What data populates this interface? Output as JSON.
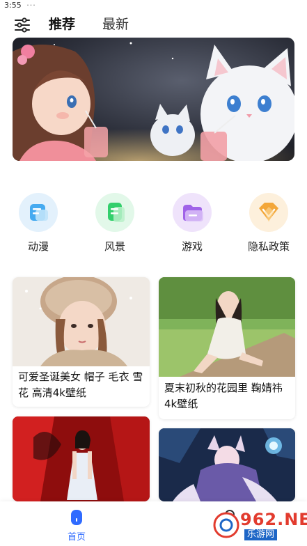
{
  "status_bar": {
    "time": "3:55",
    "more": "···"
  },
  "header": {
    "filter_icon": "sliders-icon",
    "tabs": [
      {
        "label": "推荐",
        "active": true
      },
      {
        "label": "最新",
        "active": false
      }
    ]
  },
  "categories": [
    {
      "label": "动漫",
      "icon": "anime-icon",
      "color": "#3aa7ee"
    },
    {
      "label": "风景",
      "icon": "scenery-icon",
      "color": "#2ecf6f"
    },
    {
      "label": "游戏",
      "icon": "game-icon",
      "color": "#9b5de5"
    },
    {
      "label": "隐私政策",
      "icon": "privacy-icon",
      "color": "#f2a93b"
    }
  ],
  "wallpapers": [
    {
      "title": "可爱圣诞美女 帽子 毛衣 雪花 高清4k壁纸"
    },
    {
      "title": "夏末初秋的花园里 鞠婧祎4k壁纸"
    },
    {
      "title": ""
    },
    {
      "title": ""
    }
  ],
  "bottom_nav": {
    "home_label": "首页",
    "home_icon": "home-icon",
    "mine_icon": "profile-icon"
  },
  "watermark": {
    "brand": "962.NET",
    "sub": "乐游网"
  },
  "colors": {
    "accent": "#2f6bff"
  }
}
